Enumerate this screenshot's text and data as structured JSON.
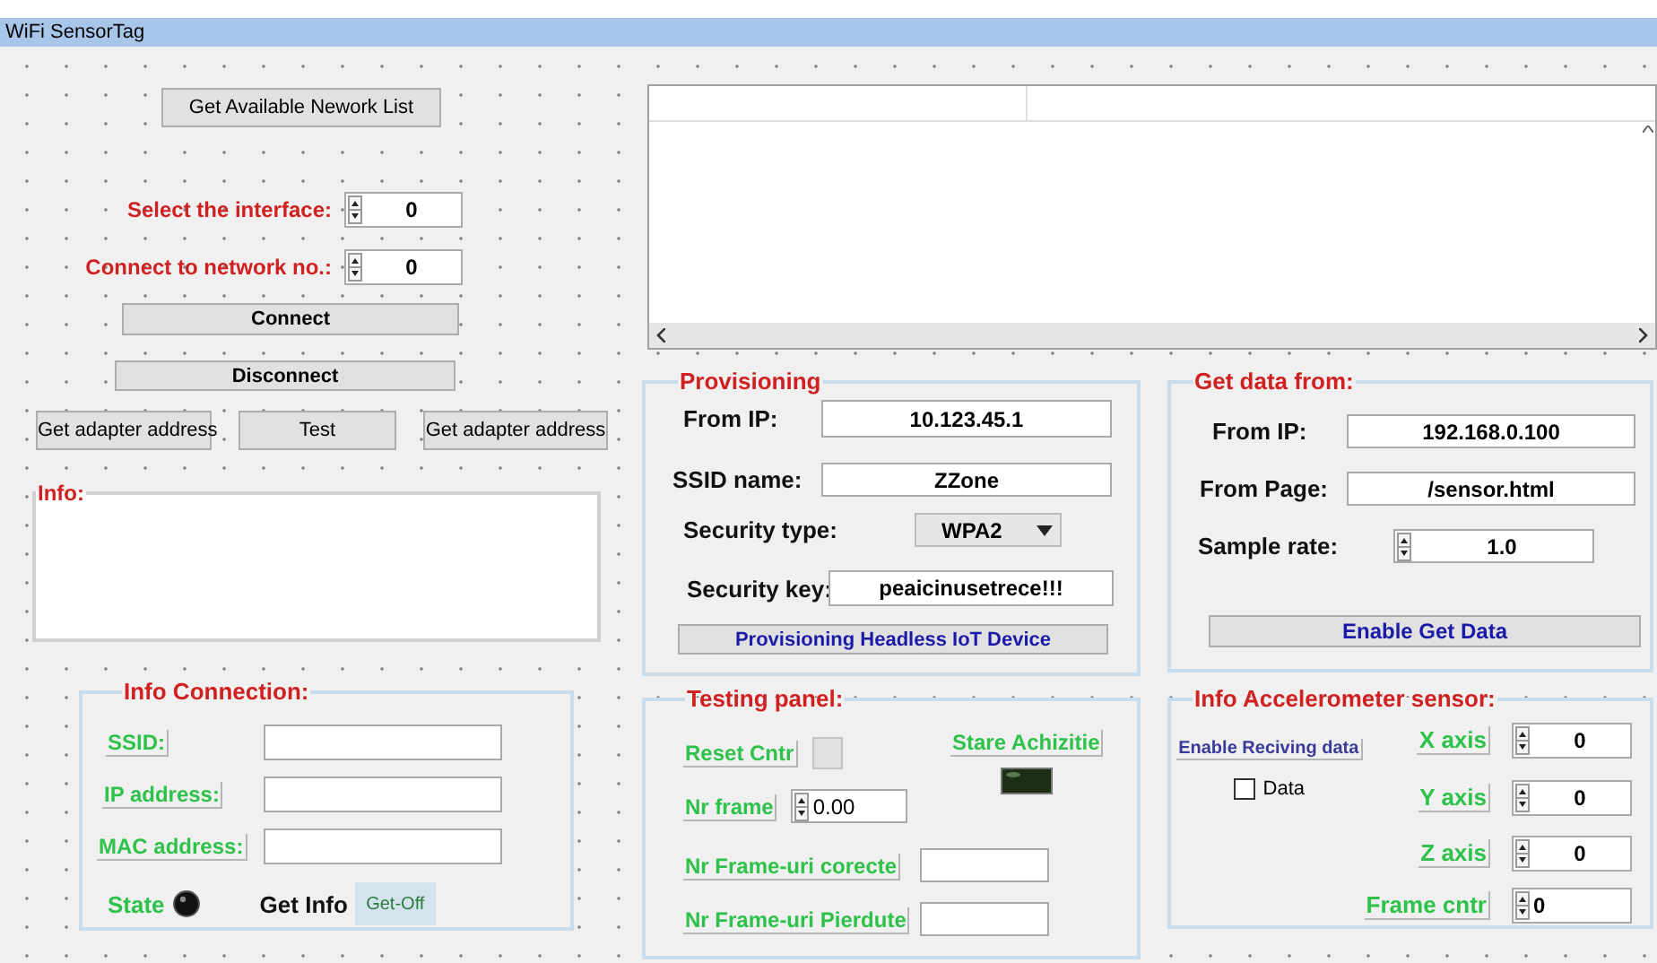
{
  "window": {
    "title": "WiFi SensorTag"
  },
  "network_list_button": "Get Available Nework List",
  "selectors": [
    {
      "label": "Select the interface:",
      "value": "0"
    },
    {
      "label": "Connect to network no.:",
      "value": "0"
    }
  ],
  "connect_button": "Connect",
  "disconnect_button": "Disconnect",
  "tool_buttons": [
    "Get adapter address",
    "Test",
    "Get adapter address"
  ],
  "info_box": {
    "title": "Info:"
  },
  "info_connection": {
    "title": "Info Connection:",
    "fields": [
      {
        "label": "SSID:"
      },
      {
        "label": "IP address:"
      },
      {
        "label": "MAC address:"
      }
    ],
    "state": {
      "label": "State",
      "on": false
    },
    "get_info": {
      "label": "Get Info",
      "button": "Get-Off"
    }
  },
  "provisioning": {
    "title": "Provisioning",
    "fields": [
      {
        "kind": "text",
        "label": "From IP:",
        "value": "10.123.45.1"
      },
      {
        "kind": "text",
        "label": "SSID name:",
        "value": "ZZone"
      },
      {
        "kind": "dropdown",
        "label": "Security type:",
        "value": "WPA2"
      },
      {
        "kind": "text",
        "label": "Security key:",
        "value": "peaicinusetrece!!!"
      }
    ],
    "button": "Provisioning Headless IoT Device"
  },
  "get_data": {
    "title": "Get data from:",
    "fields": [
      {
        "kind": "text",
        "label": "From IP:",
        "value": "192.168.0.100"
      },
      {
        "kind": "text",
        "label": "From Page:",
        "value": "/sensor.html"
      },
      {
        "kind": "spinner",
        "label": "Sample rate:",
        "value": "1.0"
      }
    ],
    "button": "Enable Get Data"
  },
  "testing_panel": {
    "title": "Testing panel:",
    "reset_label": "Reset Cntr",
    "acquisition": {
      "label": "Stare Achizitie",
      "on": false
    },
    "frame": {
      "label": "Nr frame",
      "value": "0.00"
    },
    "counters": [
      {
        "label": "Nr Frame-uri corecte"
      },
      {
        "label": "Nr Frame-uri Pierdute"
      }
    ]
  },
  "accelerometer": {
    "title": "Info Accelerometer sensor:",
    "enable_label": "Enable Reciving data",
    "data_checkbox": {
      "label": "Data",
      "checked": false
    },
    "axes": [
      {
        "kind": "axis",
        "label": "X axis",
        "value": "0"
      },
      {
        "kind": "axis",
        "label": "Y axis",
        "value": "0"
      },
      {
        "kind": "axis",
        "label": "Z axis",
        "value": "0"
      },
      {
        "kind": "counter",
        "label": "Frame cntr",
        "value": "0"
      }
    ]
  }
}
